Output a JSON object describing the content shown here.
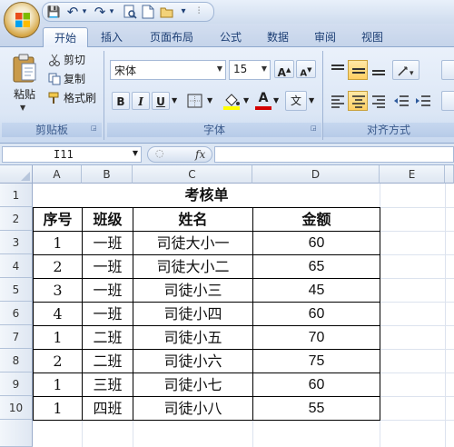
{
  "quick_access": {
    "save": "💾",
    "undo": "↶",
    "redo": "↷",
    "more": "▾",
    "title_mark": "⫶"
  },
  "tabs": [
    {
      "label": "开始",
      "active": true
    },
    {
      "label": "插入"
    },
    {
      "label": "页面布局"
    },
    {
      "label": "公式"
    },
    {
      "label": "数据"
    },
    {
      "label": "审阅"
    },
    {
      "label": "视图"
    }
  ],
  "clipboard": {
    "paste_label": "粘贴",
    "cut_label": "剪切",
    "copy_label": "复制",
    "format_painter_label": "格式刷",
    "group_title": "剪贴板"
  },
  "font": {
    "font_name": "宋体",
    "font_size": "15",
    "bold": "B",
    "italic": "I",
    "underline": "U",
    "grow": "A",
    "shrink": "A",
    "color_letter": "A",
    "phonetic": "文",
    "group_title": "字体",
    "font_color": "#d40000",
    "fill_color": "#ffff00"
  },
  "alignment": {
    "group_title": "对齐方式"
  },
  "formula_bar": {
    "name_box": "I11",
    "fx": "fx"
  },
  "sheet": {
    "columns": [
      "A",
      "B",
      "C",
      "D",
      "E"
    ],
    "rows": [
      "1",
      "2",
      "3",
      "4",
      "5",
      "6",
      "7",
      "8",
      "9",
      "10"
    ],
    "title": "考核单",
    "headers": [
      "序号",
      "班级",
      "姓名",
      "金额"
    ],
    "data": [
      [
        "1",
        "一班",
        "司徒大小一",
        "60"
      ],
      [
        "2",
        "一班",
        "司徒大小二",
        "65"
      ],
      [
        "3",
        "一班",
        "司徒小三",
        "45"
      ],
      [
        "4",
        "一班",
        "司徒小四",
        "60"
      ],
      [
        "1",
        "二班",
        "司徒小五",
        "70"
      ],
      [
        "2",
        "二班",
        "司徒小六",
        "75"
      ],
      [
        "1",
        "三班",
        "司徒小七",
        "60"
      ],
      [
        "1",
        "四班",
        "司徒小八",
        "55"
      ]
    ]
  }
}
